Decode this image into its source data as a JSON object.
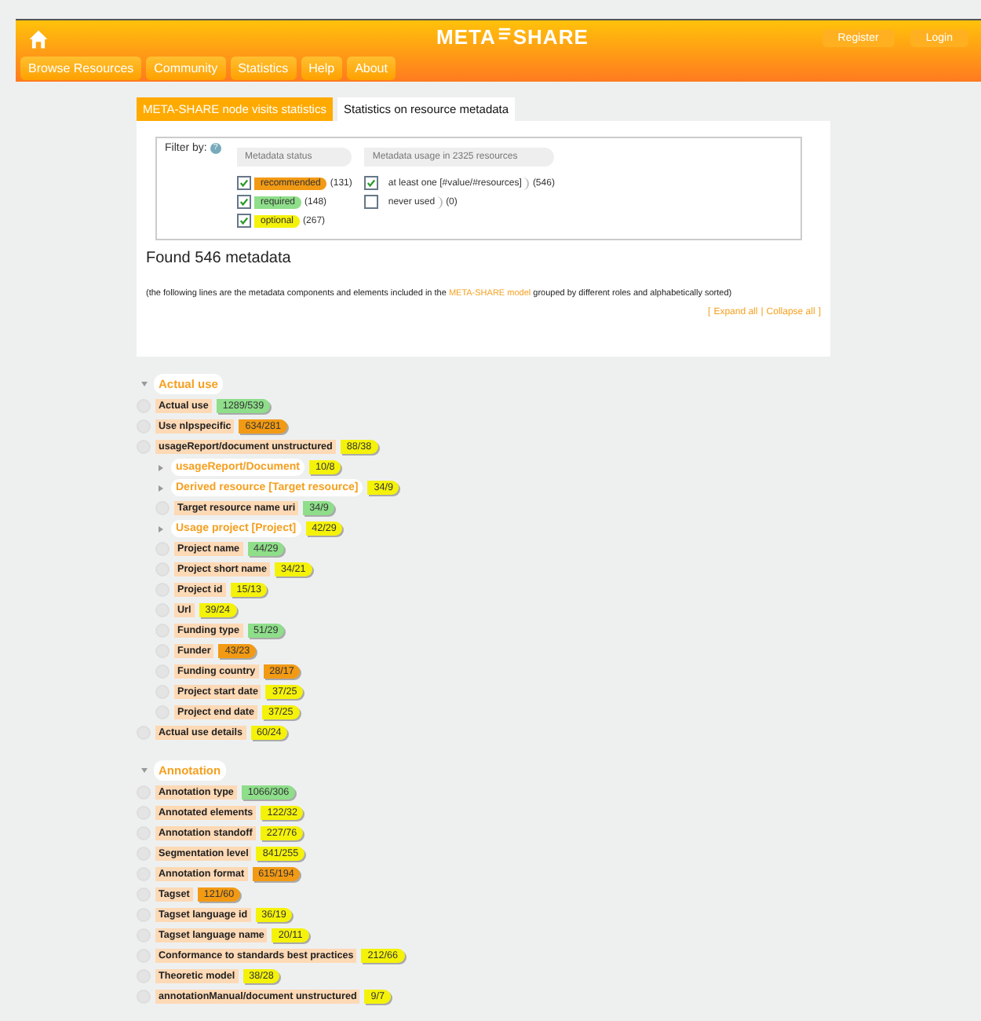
{
  "header": {
    "logo": "META",
    "logo_2": "SHARE",
    "nav": [
      "Browse Resources",
      "Community",
      "Statistics",
      "Help",
      "About"
    ],
    "account": [
      "Register",
      "Login"
    ]
  },
  "tabs": [
    {
      "label": "META-SHARE node visits statistics",
      "selected": false
    },
    {
      "label": "Statistics on resource metadata",
      "selected": true
    }
  ],
  "filter": {
    "label": "Filter by:",
    "help": "?",
    "status_title": "Metadata status",
    "usage_title": "Metadata usage in 2325 resources",
    "status": [
      {
        "label": "recommended",
        "count": "(131)",
        "checked": true,
        "color": "#f29a14"
      },
      {
        "label": "required",
        "count": "(148)",
        "checked": true,
        "color": "#8ede8a"
      },
      {
        "label": "optional",
        "count": "(267)",
        "checked": true,
        "color": "#f5f20a"
      }
    ],
    "usage": [
      {
        "label": "at least one [#value/#resources]",
        "count": "(546)",
        "checked": true
      },
      {
        "label": "never used",
        "count": "(0)",
        "checked": false
      }
    ]
  },
  "found": "Found 546 metadata",
  "note": {
    "before": "(the following lines are the metadata components and elements included in the ",
    "link": "META-SHARE model",
    "after": " grouped by different roles and alphabetically sorted)"
  },
  "links": {
    "open": "[",
    "expand": "Expand all",
    "separator": "|",
    "collapse": "Collapse all",
    "close": "]"
  },
  "sections": [
    {
      "title": "Actual use",
      "expanded": true,
      "items": [
        {
          "kind": "element",
          "name": "Actual use",
          "value": "1289/539",
          "color": "#8ede8a"
        },
        {
          "kind": "element",
          "name": "Use nlpspecific",
          "value": "634/281",
          "color": "#f29a14"
        },
        {
          "kind": "element",
          "name": "usageReport/document unstructured",
          "value": "88/38",
          "color": "#f5f20a",
          "children": [
            {
              "kind": "component",
              "name": "usageReport/Document",
              "value": "10/8",
              "color": "#f5f20a"
            },
            {
              "kind": "component",
              "name": "Derived resource [Target resource]",
              "value": "34/9",
              "color": "#f5f20a"
            },
            {
              "kind": "element",
              "name": "Target resource name uri",
              "value": "34/9",
              "color": "#8ede8a"
            },
            {
              "kind": "component",
              "name": "Usage project [Project]",
              "value": "42/29",
              "color": "#f5f20a"
            },
            {
              "kind": "element",
              "name": "Project name",
              "value": "44/29",
              "color": "#8ede8a"
            },
            {
              "kind": "element",
              "name": "Project short name",
              "value": "34/21",
              "color": "#f5f20a"
            },
            {
              "kind": "element",
              "name": "Project id",
              "value": "15/13",
              "color": "#f5f20a"
            },
            {
              "kind": "element",
              "name": "Url",
              "value": "39/24",
              "color": "#f5f20a"
            },
            {
              "kind": "element",
              "name": "Funding type",
              "value": "51/29",
              "color": "#8ede8a"
            },
            {
              "kind": "element",
              "name": "Funder",
              "value": "43/23",
              "color": "#f29a14"
            },
            {
              "kind": "element",
              "name": "Funding country",
              "value": "28/17",
              "color": "#f29a14"
            },
            {
              "kind": "element",
              "name": "Project start date",
              "value": "37/25",
              "color": "#f5f20a"
            },
            {
              "kind": "element",
              "name": "Project end date",
              "value": "37/25",
              "color": "#f5f20a"
            }
          ]
        },
        {
          "kind": "element",
          "name": "Actual use details",
          "value": "60/24",
          "color": "#f5f20a"
        }
      ]
    },
    {
      "title": "Annotation",
      "expanded": true,
      "items": [
        {
          "kind": "element",
          "name": "Annotation type",
          "value": "1066/306",
          "color": "#8ede8a"
        },
        {
          "kind": "element",
          "name": "Annotated elements",
          "value": "122/32",
          "color": "#f5f20a"
        },
        {
          "kind": "element",
          "name": "Annotation standoff",
          "value": "227/76",
          "color": "#f5f20a"
        },
        {
          "kind": "element",
          "name": "Segmentation level",
          "value": "841/255",
          "color": "#f5f20a"
        },
        {
          "kind": "element",
          "name": "Annotation format",
          "value": "615/194",
          "color": "#f29a14"
        },
        {
          "kind": "element",
          "name": "Tagset",
          "value": "121/60",
          "color": "#f29a14"
        },
        {
          "kind": "element",
          "name": "Tagset language id",
          "value": "36/19",
          "color": "#f5f20a"
        },
        {
          "kind": "element",
          "name": "Tagset language name",
          "value": "20/11",
          "color": "#f5f20a"
        },
        {
          "kind": "element",
          "name": "Conformance to standards best practices",
          "value": "212/66",
          "color": "#f5f20a"
        },
        {
          "kind": "element",
          "name": "Theoretic model",
          "value": "38/28",
          "color": "#f5f20a"
        },
        {
          "kind": "element",
          "name": "annotationManual/document unstructured",
          "value": "9/7",
          "color": "#f5f20a"
        }
      ]
    }
  ]
}
